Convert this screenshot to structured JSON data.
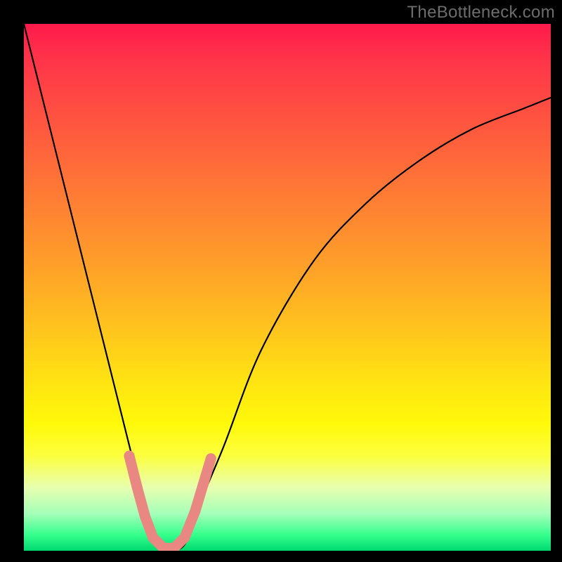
{
  "watermark": "TheBottleneck.com",
  "chart_data": {
    "type": "line",
    "title": "",
    "xlabel": "",
    "ylabel": "",
    "xlim": [
      0,
      100
    ],
    "ylim": [
      0,
      100
    ],
    "grid": false,
    "legend": false,
    "series": [
      {
        "name": "curve",
        "x": [
          0,
          5,
          10,
          15,
          20,
          23,
          25,
          27,
          29,
          31,
          33,
          38,
          45,
          55,
          65,
          75,
          85,
          95,
          100
        ],
        "y": [
          100,
          80,
          60,
          40,
          20,
          8,
          2,
          0,
          0,
          2,
          8,
          20,
          38,
          55,
          66,
          74,
          80,
          84,
          86
        ]
      }
    ],
    "markers": {
      "name": "highlighted-segments",
      "color": "#e98882",
      "points": [
        {
          "x": 20.0,
          "y": 18.0
        },
        {
          "x": 21.5,
          "y": 12.0
        },
        {
          "x": 23.0,
          "y": 6.5
        },
        {
          "x": 24.5,
          "y": 2.5
        },
        {
          "x": 26.5,
          "y": 0.5
        },
        {
          "x": 28.5,
          "y": 0.5
        },
        {
          "x": 30.5,
          "y": 2.5
        },
        {
          "x": 32.5,
          "y": 7.5
        },
        {
          "x": 34.0,
          "y": 12.5
        },
        {
          "x": 35.5,
          "y": 17.5
        }
      ]
    },
    "background_gradient_stops": [
      {
        "pct": 0,
        "color": "#ff1a4b"
      },
      {
        "pct": 18,
        "color": "#ff5340"
      },
      {
        "pct": 46,
        "color": "#ffa029"
      },
      {
        "pct": 76,
        "color": "#fff90a"
      },
      {
        "pct": 100,
        "color": "#00d96f"
      }
    ]
  }
}
